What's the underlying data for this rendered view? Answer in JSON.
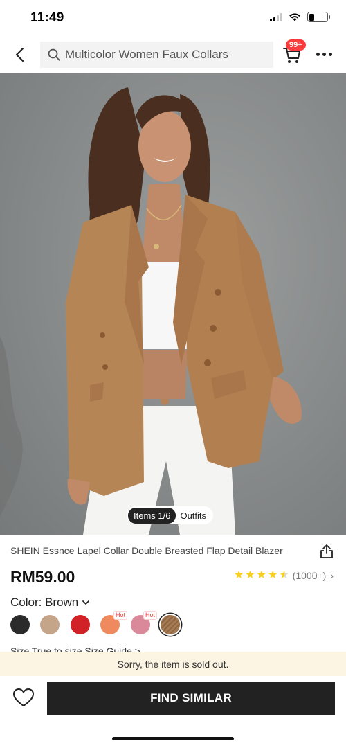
{
  "status_bar": {
    "time": "11:49"
  },
  "header": {
    "search_text": "Multicolor Women Faux Collars",
    "cart_badge": "99+"
  },
  "gallery": {
    "active_tab": "Items 1/6",
    "other_tab": "Outfits"
  },
  "product": {
    "title": "SHEIN Essnce Lapel Collar Double Breasted Flap Detail Blazer",
    "price": "RM59.00",
    "rating_stars": 4.5,
    "review_count": "(1000+)",
    "color_label": "Color: Brown",
    "swatches": [
      {
        "name": "black",
        "color": "#2b2b2b",
        "hot": false,
        "selected": false
      },
      {
        "name": "khaki",
        "color": "#c5a58a",
        "hot": false,
        "selected": false
      },
      {
        "name": "red",
        "color": "#d12227",
        "hot": false,
        "selected": false
      },
      {
        "name": "coral",
        "color": "#ee8a5e",
        "hot": true,
        "selected": false
      },
      {
        "name": "pink",
        "color": "#d9899a",
        "hot": true,
        "selected": false
      },
      {
        "name": "brown",
        "color": "#a67a52",
        "hot": false,
        "selected": true
      }
    ],
    "hot_label": "Hot",
    "peek_text": "Size  True to size                                                         Size Guide >"
  },
  "notice": {
    "sold_out": "Sorry, the item is sold out."
  },
  "actions": {
    "find_similar": "FIND SIMILAR"
  },
  "colors": {
    "accent_red": "#fa3c3c",
    "star": "#facf19",
    "banner": "#fdf5e4",
    "button": "#222222"
  }
}
